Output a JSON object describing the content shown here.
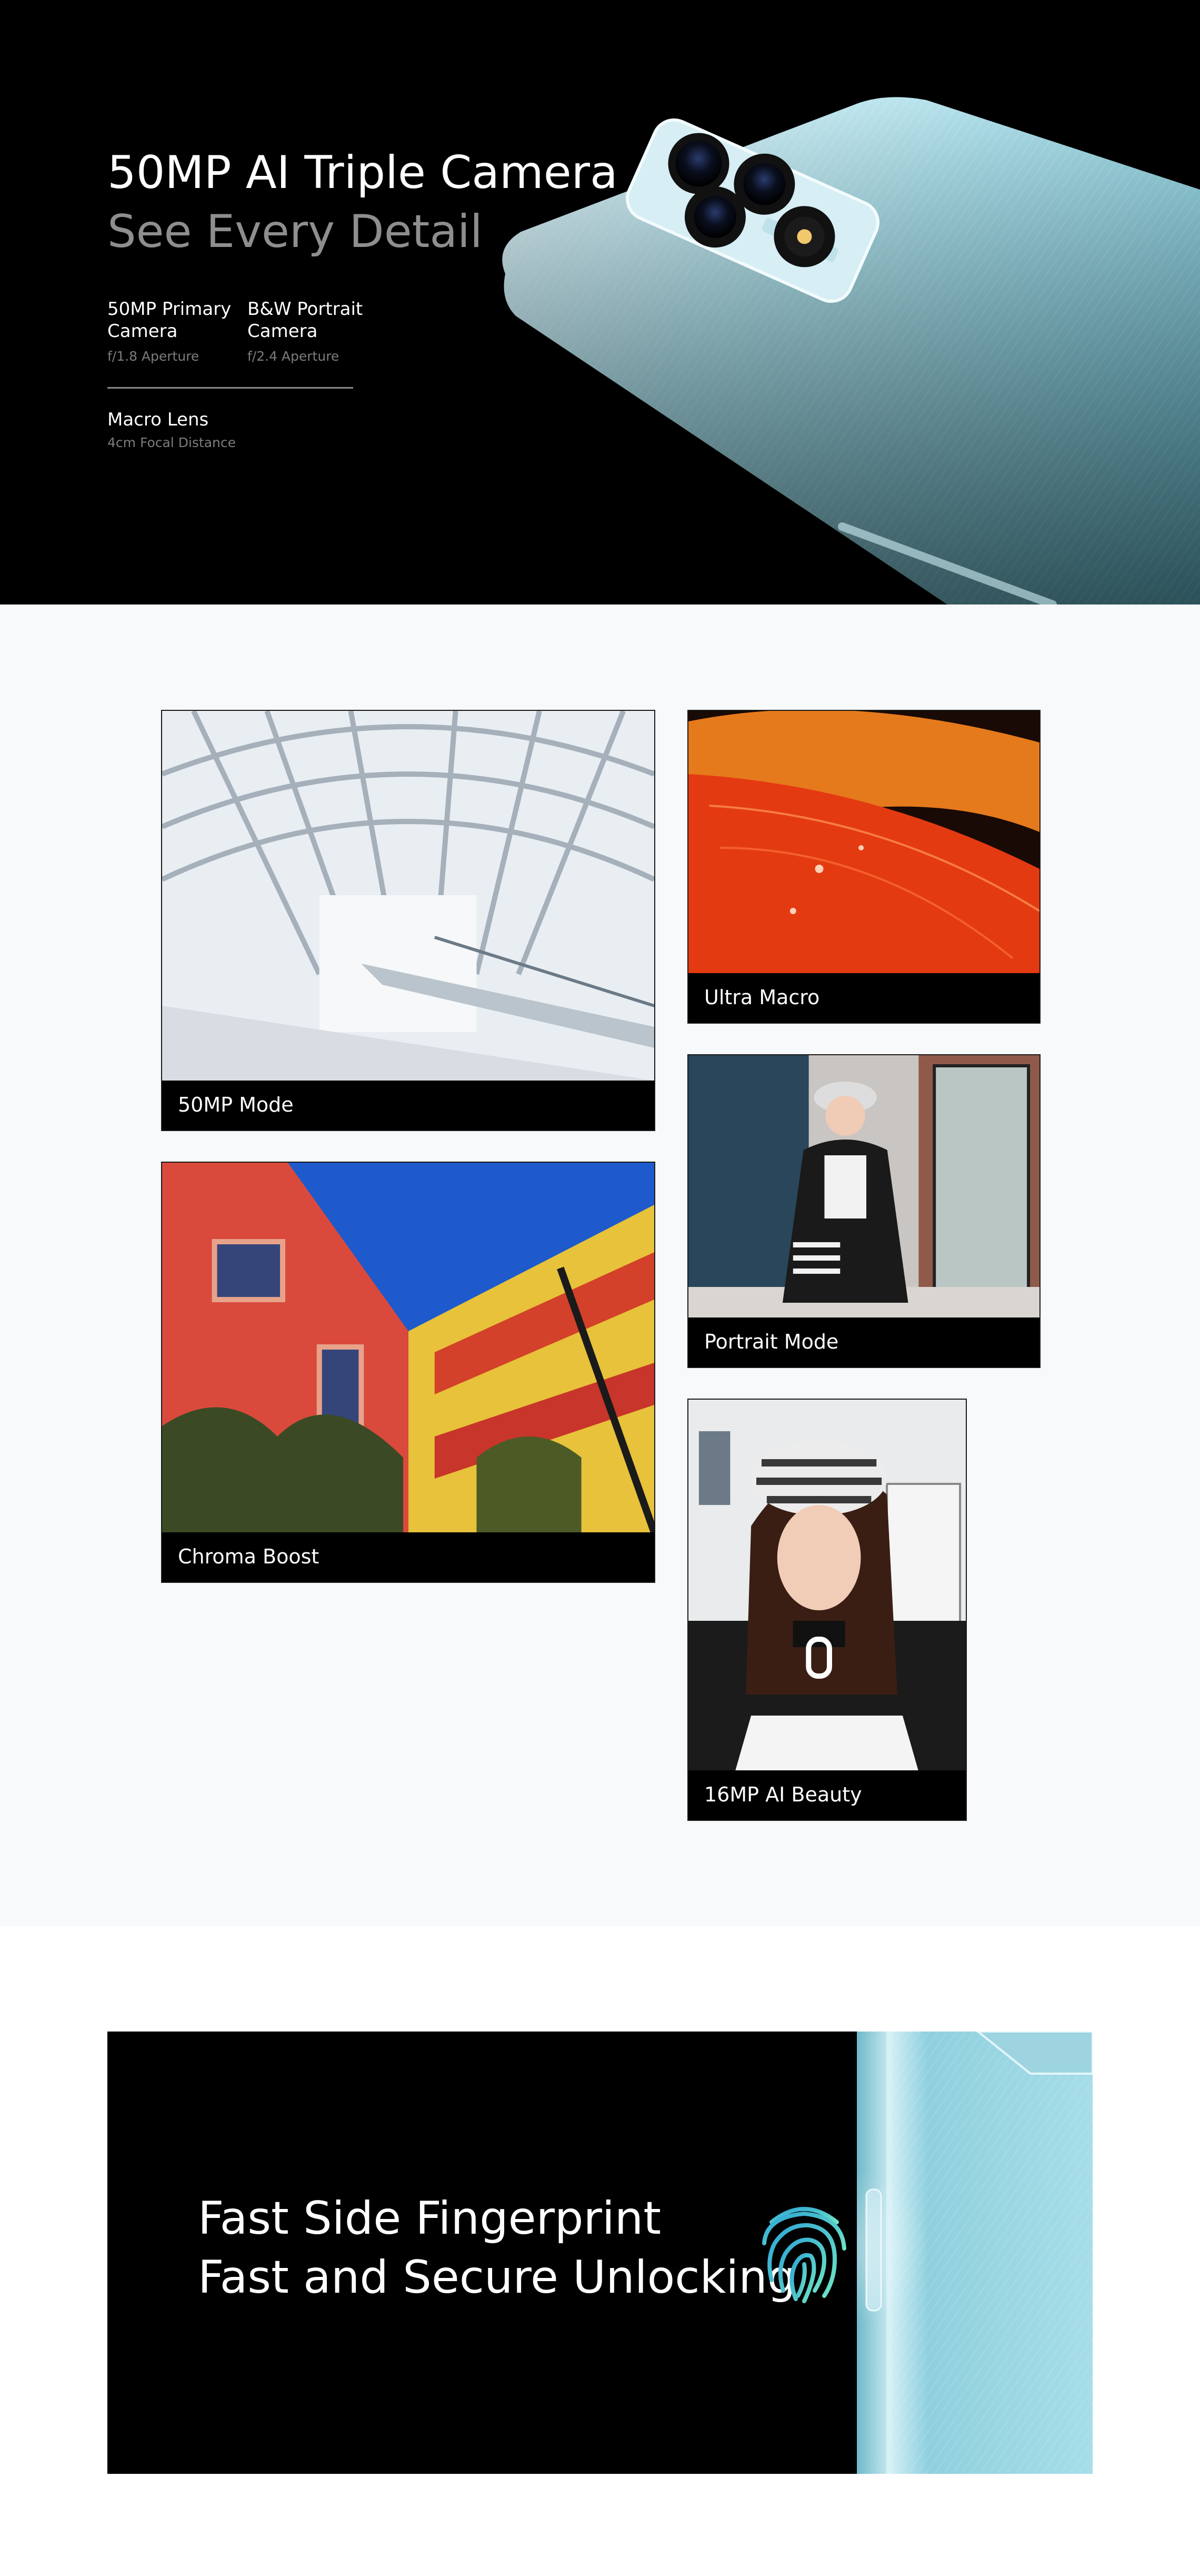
{
  "hero": {
    "title": "50MP AI Triple Camera",
    "subtitle": "See Every Detail",
    "specs": [
      {
        "name": "50MP Primary Camera",
        "detail": "f/1.8 Aperture"
      },
      {
        "name": "B&W Portrait Camera",
        "detail": "f/2.4 Aperture"
      },
      {
        "name": "Macro Lens",
        "detail": "4cm Focal Distance"
      }
    ],
    "phone_color": "#9fd9e6"
  },
  "gallery": {
    "background": "#f8f9fb",
    "cards": [
      {
        "caption": "50MP Mode"
      },
      {
        "caption": "Ultra Macro"
      },
      {
        "caption": "Portrait Mode"
      },
      {
        "caption": "Chroma Boost"
      },
      {
        "caption": "16MP AI Beauty"
      }
    ]
  },
  "fingerprint": {
    "line1": "Fast Side Fingerprint",
    "line2": "Fast and Secure Unlocking",
    "accent": "#4fd0c8"
  }
}
